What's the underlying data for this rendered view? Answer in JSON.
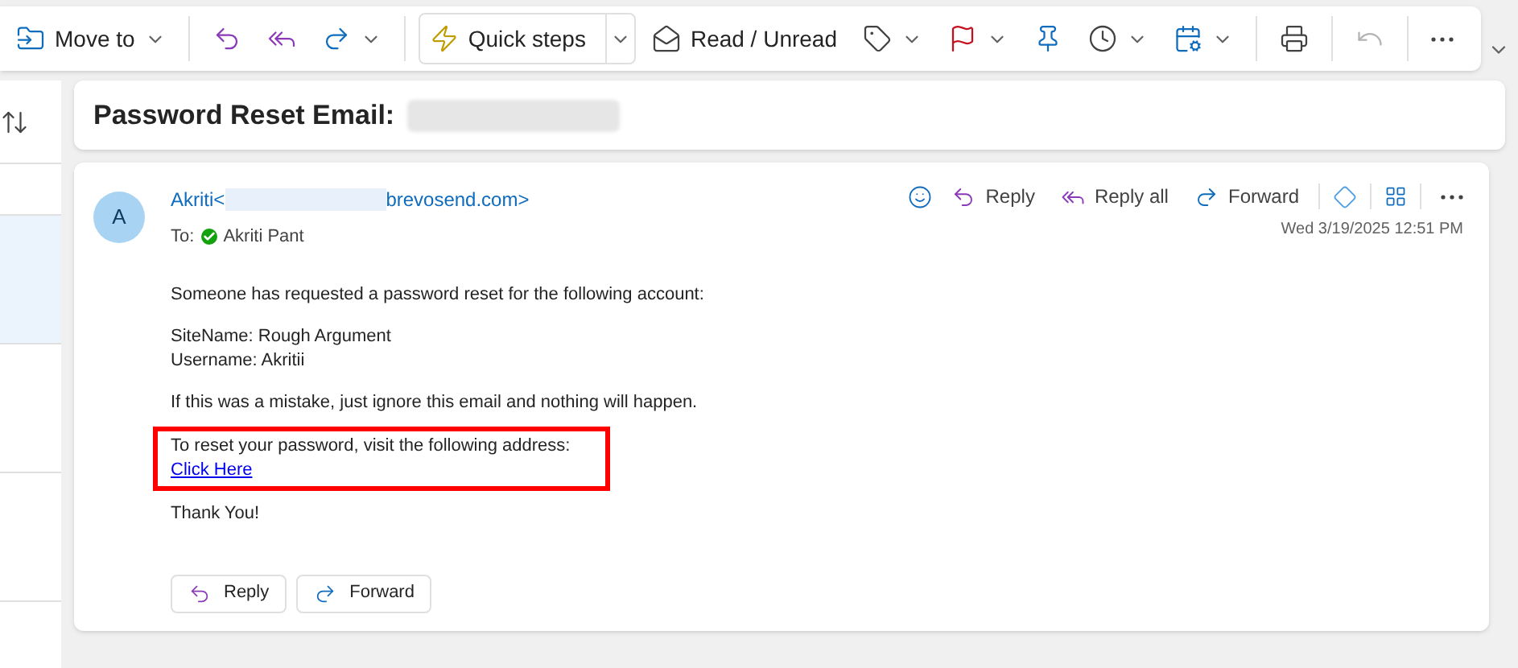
{
  "toolbar": [
    {
      "kind": "button",
      "label": "Move to",
      "menu": true,
      "disabled": false
    },
    {
      "kind": "divider"
    },
    {
      "kind": "button",
      "menu": false,
      "disabled": false
    },
    {
      "kind": "button",
      "menu": false,
      "disabled": false
    },
    {
      "kind": "button",
      "menu": true,
      "disabled": false
    },
    {
      "kind": "divider"
    },
    {
      "kind": "button",
      "label": "Quick steps",
      "menu": true,
      "disabled": false,
      "split": true
    },
    {
      "kind": "button",
      "label": "Read / Unread",
      "menu": false,
      "disabled": false
    },
    {
      "kind": "button",
      "menu": true,
      "disabled": false
    },
    {
      "kind": "button",
      "menu": true,
      "disabled": false
    },
    {
      "kind": "button",
      "menu": false,
      "disabled": false
    },
    {
      "kind": "button",
      "menu": true,
      "disabled": false
    },
    {
      "kind": "button",
      "menu": true,
      "disabled": false
    },
    {
      "kind": "divider"
    },
    {
      "kind": "button",
      "menu": false,
      "disabled": false
    },
    {
      "kind": "divider"
    },
    {
      "kind": "button",
      "menu": false,
      "disabled": true
    },
    {
      "kind": "divider"
    },
    {
      "kind": "button",
      "menu": false,
      "disabled": false
    }
  ],
  "subject": "Password Reset Email:",
  "message": {
    "avatar": "A",
    "sender_start": "Akriti<",
    "sender_end": "brevosend.com>",
    "to_label": "To:",
    "recipient": "Akriti Pant",
    "date": "Wed 3/19/2025 12:51 PM",
    "actions": [
      "Reply",
      "Reply all",
      "Forward"
    ],
    "paragraphs": [
      {
        "lines": [
          "Someone has requested a password reset for the following account:"
        ],
        "highlighted": false
      },
      {
        "lines": [
          "SiteName: Rough Argument",
          "Username: Akritii"
        ],
        "highlighted": false
      },
      {
        "lines": [
          "If this was a mistake, just ignore this email and nothing will happen."
        ],
        "highlighted": false
      },
      {
        "lines": [
          "To reset your password, visit the following address:"
        ],
        "link": "Click Here",
        "highlighted": true
      },
      {
        "lines": [
          "Thank You!"
        ],
        "highlighted": false
      }
    ],
    "footer_buttons": [
      "Reply",
      "Forward"
    ]
  }
}
